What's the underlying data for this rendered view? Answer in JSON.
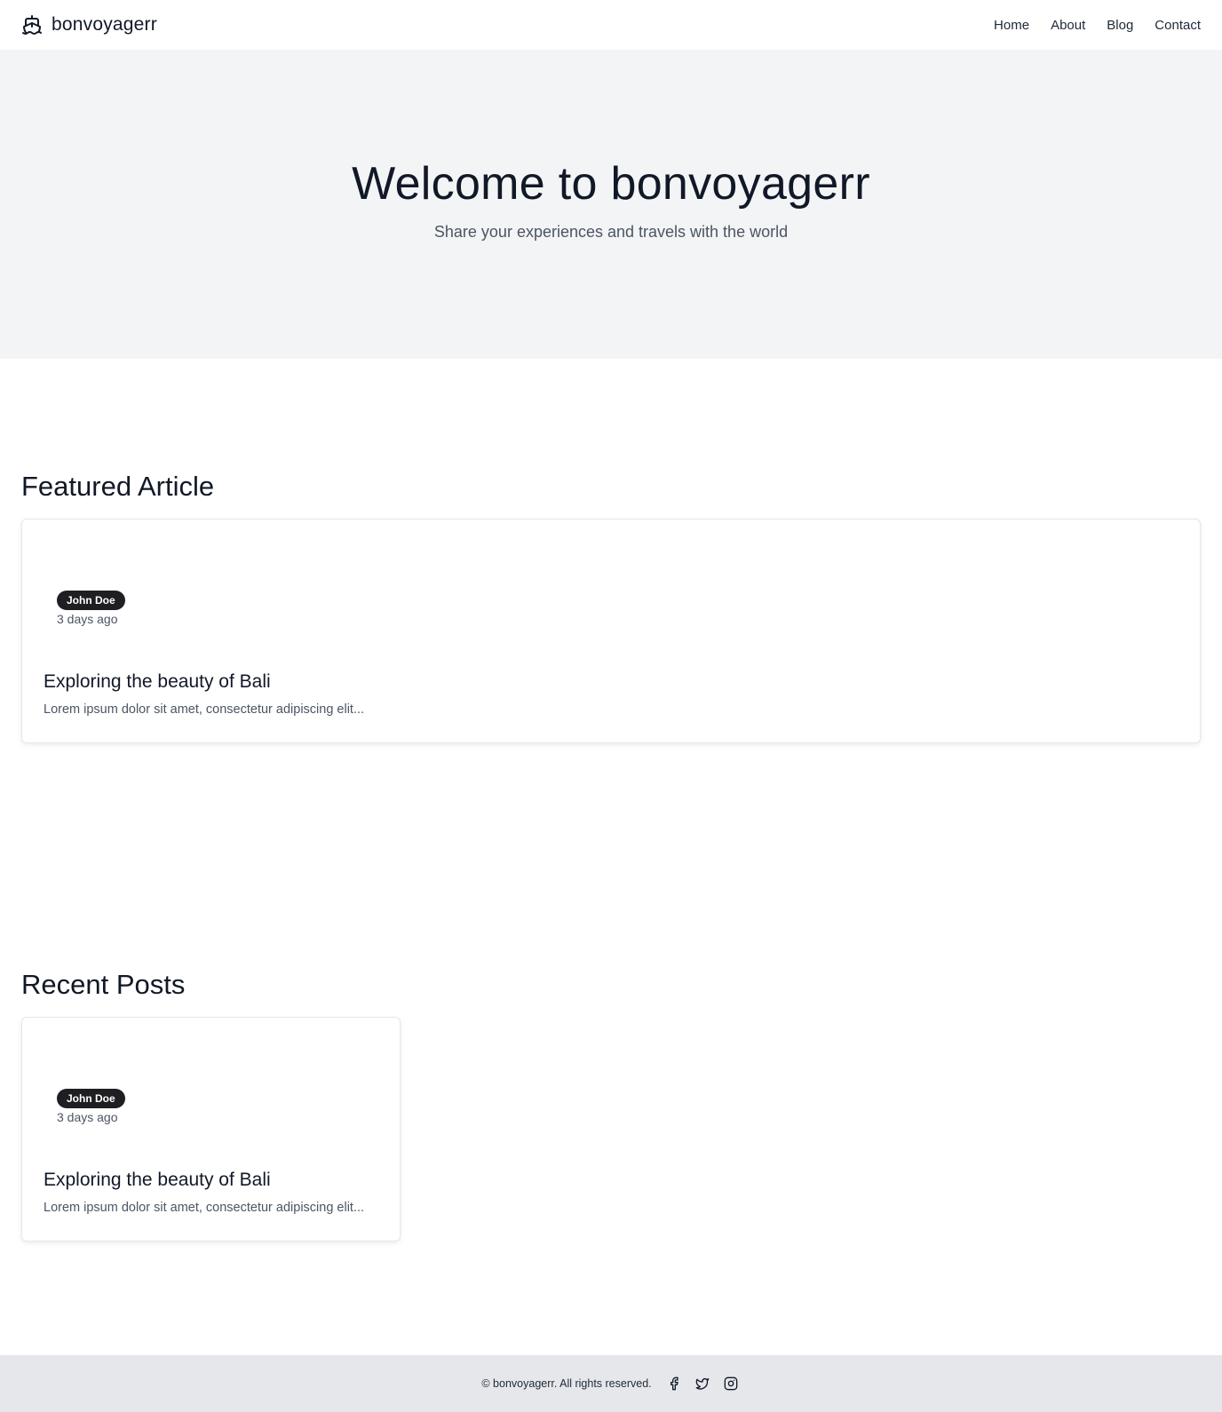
{
  "header": {
    "brand_name": "bonvoyagerr",
    "brand_icon": "ship-icon",
    "nav": [
      {
        "label": "Home"
      },
      {
        "label": "About"
      },
      {
        "label": "Blog"
      },
      {
        "label": "Contact"
      }
    ]
  },
  "hero": {
    "title": "Welcome to bonvoyagerr",
    "subtitle": "Share your experiences and travels with the world"
  },
  "featured": {
    "heading": "Featured Article",
    "post": {
      "author": "John Doe",
      "time": "3 days ago",
      "title": "Exploring the beauty of Bali",
      "excerpt": "Lorem ipsum dolor sit amet, consectetur adipiscing elit..."
    }
  },
  "recent": {
    "heading": "Recent Posts",
    "posts": [
      {
        "author": "John Doe",
        "time": "3 days ago",
        "title": "Exploring the beauty of Bali",
        "excerpt": "Lorem ipsum dolor sit amet, consectetur adipiscing elit..."
      }
    ]
  },
  "footer": {
    "copyright": "© bonvoyagerr. All rights reserved.",
    "social_icons": [
      "facebook-icon",
      "twitter-icon",
      "instagram-icon"
    ]
  }
}
